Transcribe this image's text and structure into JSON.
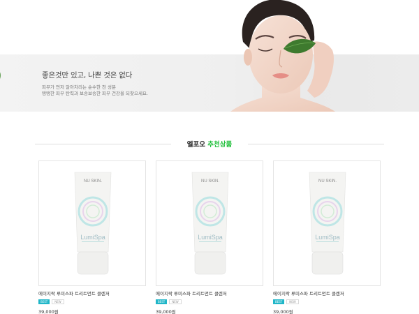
{
  "hero": {
    "headline": "좋은것만 있고, 나쁜 것은 없다",
    "sub_line1": "피부가 먼저 알아차리는 순수한 천 성분",
    "sub_line2": "탱탱한 피부 탄력과 보송보송한 피부 건강을 되찾으세요."
  },
  "section": {
    "brand": "엘포오",
    "title": "추천상품",
    "accent_color": "#1fbf3a"
  },
  "products": [
    {
      "name": "에이지락 루미스파 트리트먼트 클렌저",
      "badge1": "BEST",
      "badge2": "NEW",
      "price": "39,000원",
      "tube_brand": "NU SKIN.",
      "tube_line": "LumiSpa"
    },
    {
      "name": "에이지락 루미스파 트리트먼트 클렌저",
      "badge1": "BEST",
      "badge2": "NEW",
      "price": "39,000원",
      "tube_brand": "NU SKIN.",
      "tube_line": "LumiSpa"
    },
    {
      "name": "에이지락 루미스파 트리트먼트 클렌저",
      "badge1": "BEST",
      "badge2": "NEW",
      "price": "39,000원",
      "tube_brand": "NU SKIN.",
      "tube_line": "LumiSpa"
    }
  ]
}
